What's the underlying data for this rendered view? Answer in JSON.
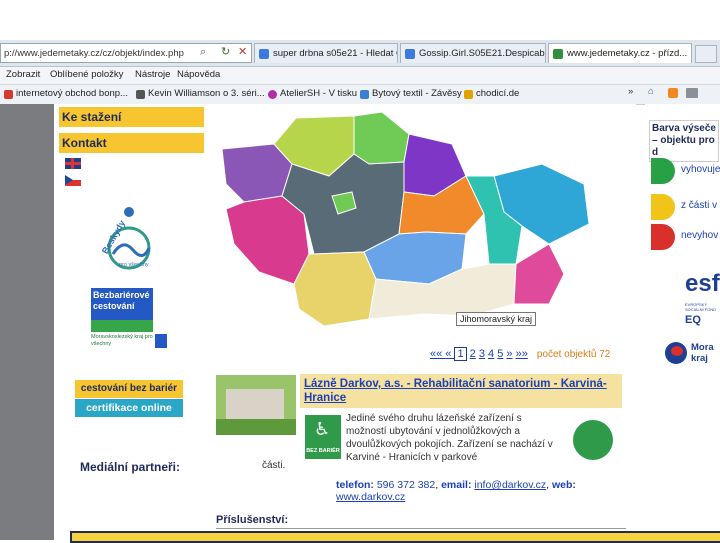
{
  "browser": {
    "address": "p://www.jedemetaky.cz/cz/objekt/index.php",
    "tabs": [
      {
        "label": "super drbna s05e21 - Hledat G...",
        "color": "#3b7ae0"
      },
      {
        "label": "Gossip.Girl.S05E21.Despicable...",
        "color": "#3b7ae0"
      },
      {
        "label": "www.jedemetaky.cz - přízd...",
        "color": "#2f8f3a"
      }
    ],
    "menu": [
      "Zobrazit",
      "Oblíbené položky",
      "Nástroje",
      "Nápověda"
    ],
    "favorites": [
      {
        "label": "internetový obchod bonp...",
        "color": "#d43b2a"
      },
      {
        "label": "Kevin Williamson o 3. séri...",
        "color": "#555"
      },
      {
        "label": "AtelierSH - V tisku",
        "color": "#b02fa8"
      },
      {
        "label": "Bytový textil - Závěsy",
        "color": "#3a7fd0"
      },
      {
        "label": "chodicí.de",
        "color": "#e0a400"
      }
    ]
  },
  "sidebar": {
    "items": [
      {
        "label": "Ke stažení"
      },
      {
        "label": "Kontakt"
      }
    ],
    "logos": {
      "beskydy": "Beskydy",
      "beskydy_sub": "pro všechny",
      "bezbarier_line1": "Bezbariérové",
      "bezbarier_line2": "cestování",
      "bezbarier_sub": "Moravskoslezský kraj pro všechny",
      "cert_line1": "cestování bez bariér",
      "cert_line2": "certifikace online"
    },
    "partners_label": "Mediální partneři:"
  },
  "map": {
    "tooltip": "Jihomoravský kraj",
    "regions": [
      {
        "name": "Karlovarský kraj",
        "color": "#8a57b6"
      },
      {
        "name": "Ústecký kraj",
        "color": "#b7d54a"
      },
      {
        "name": "Liberecký kraj",
        "color": "#6fcb56"
      },
      {
        "name": "Královéhradecký kraj",
        "color": "#7e36c7"
      },
      {
        "name": "Plzeňský kraj",
        "color": "#d83a8e"
      },
      {
        "name": "Středočeský kraj",
        "color": "#5a6b78"
      },
      {
        "name": "Praha",
        "color": "#6fcb56"
      },
      {
        "name": "Pardubický kraj",
        "color": "#f08a2a"
      },
      {
        "name": "Moravskoslezský kraj",
        "color": "#2ea7d6"
      },
      {
        "name": "Olomoucký kraj",
        "color": "#2fc2b0"
      },
      {
        "name": "Jihočeský kraj",
        "color": "#e7d36a"
      },
      {
        "name": "Vysočina",
        "color": "#6aa4e8"
      },
      {
        "name": "Jihomoravský kraj",
        "color": "#f1ecd9"
      },
      {
        "name": "Zlínský kraj",
        "color": "#e04a9a"
      }
    ]
  },
  "pager": {
    "prev_all": "«« ",
    "prev": "« ",
    "pages": [
      "1",
      "2",
      "3",
      "4",
      "5"
    ],
    "next": " »",
    "next_all": " »»",
    "count_text": "počet objektů 72"
  },
  "listing": {
    "title": "Lázně Darkov, a.s. - Rehabilitační sanatorium - Karviná-Hranice",
    "description": "Jediné svého druhu lázeňské zařízení s možností ubytování v jednolůžkových a dvoulůžkových pokojích. Zařízení se nachází v Karviné - Hranicích v parkové",
    "description_tail": "části.",
    "badge": "BEZ BARIÉR",
    "phone_label": "telefon:",
    "phone": "596 372 382",
    "email_label": "email:",
    "email": "info@darkov.cz",
    "web_label": "web:",
    "web": "www.darkov.cz",
    "accessories_label": "Příslušenství:"
  },
  "right_panel": {
    "title": "Barva výseče – objektu pro d",
    "legend": [
      {
        "label": "vyhovuje",
        "color": "#27a046"
      },
      {
        "label": "z části v",
        "color": "#f0c419"
      },
      {
        "label": "nevyhov",
        "color": "#d9302c"
      }
    ],
    "eu_logo": "esf",
    "eu_sub": "EVROPSKÝ SOCIÁLNÍ FOND",
    "eq": "EQ",
    "region_logo": "Mora kraj"
  }
}
